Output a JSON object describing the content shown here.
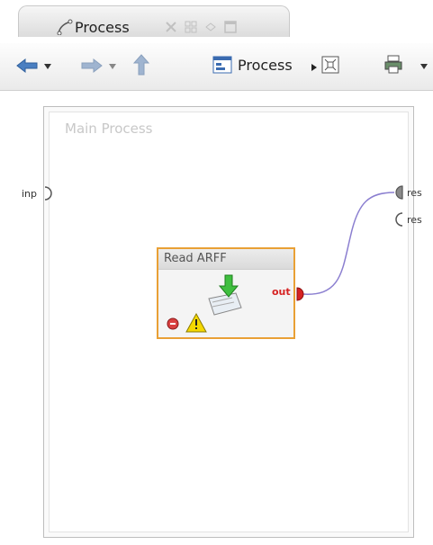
{
  "tab": {
    "title": "Process"
  },
  "toolbar": {
    "breadcrumb": "Process"
  },
  "canvas": {
    "title": "Main Process",
    "input_port": "inp",
    "result_ports": [
      "res",
      "res"
    ]
  },
  "operator": {
    "name": "Read ARFF",
    "output_port": "out"
  },
  "icons": {
    "tab": "process-icon",
    "back": "arrow-left-icon",
    "forward": "arrow-right-icon",
    "up": "arrow-up-icon",
    "process": "process-window-icon",
    "layout": "auto-layout-icon",
    "print": "printer-icon",
    "operator": "read-arff-icon",
    "error": "error-icon",
    "warning": "warning-icon"
  },
  "colors": {
    "operator_border": "#e9a035",
    "nav_arrows": "#4a7fc1",
    "output_port": "#d62222",
    "connection": "#8b7fd0"
  }
}
